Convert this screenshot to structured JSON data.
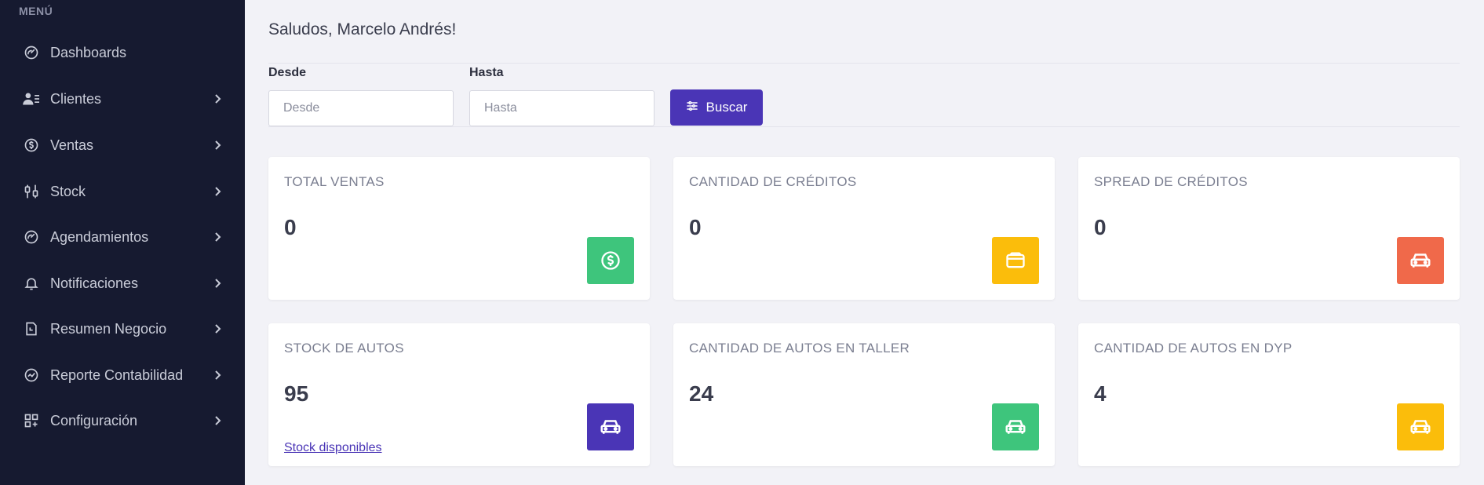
{
  "sidebar": {
    "heading": "MENÚ",
    "items": [
      {
        "label": "Dashboards",
        "icon": "gauge-icon",
        "has_chevron": false
      },
      {
        "label": "Clientes",
        "icon": "user-list-icon",
        "has_chevron": true
      },
      {
        "label": "Ventas",
        "icon": "dollar-cycle-icon",
        "has_chevron": true
      },
      {
        "label": "Stock",
        "icon": "sliders-icon",
        "has_chevron": true
      },
      {
        "label": "Agendamientos",
        "icon": "gauge-icon",
        "has_chevron": true
      },
      {
        "label": "Notificaciones",
        "icon": "bell-icon",
        "has_chevron": true
      },
      {
        "label": "Resumen Negocio",
        "icon": "document-icon",
        "has_chevron": true
      },
      {
        "label": "Reporte Contabilidad",
        "icon": "chart-circle-icon",
        "has_chevron": true
      },
      {
        "label": "Configuración",
        "icon": "grid-plus-icon",
        "has_chevron": true
      }
    ]
  },
  "main": {
    "greeting": "Saludos, Marcelo Andrés!",
    "filters": {
      "desde_label": "Desde",
      "desde_placeholder": "Desde",
      "hasta_label": "Hasta",
      "hasta_placeholder": "Hasta",
      "buscar_label": "Buscar"
    },
    "cards": [
      {
        "title": "TOTAL VENTAS",
        "value": "0",
        "icon": "dollar-circle-icon",
        "color": "#3ec57c"
      },
      {
        "title": "CANTIDAD DE CRÉDITOS",
        "value": "0",
        "icon": "wallet-icon",
        "color": "#fbbd0b"
      },
      {
        "title": "SPREAD DE CRÉDITOS",
        "value": "0",
        "icon": "car-icon",
        "color": "#f0694a"
      },
      {
        "title": "STOCK DE AUTOS",
        "value": "95",
        "icon": "car-icon",
        "color": "#4a35b6",
        "link": "Stock disponibles"
      },
      {
        "title": "CANTIDAD DE AUTOS EN TALLER",
        "value": "24",
        "icon": "car-icon",
        "color": "#3ec57c"
      },
      {
        "title": "CANTIDAD DE AUTOS EN DYP",
        "value": "4",
        "icon": "car-icon",
        "color": "#fbbd0b"
      }
    ]
  },
  "colors": {
    "sidebar_bg": "#161a30",
    "page_bg": "#f2f2f7",
    "accent": "#4a35b6"
  }
}
